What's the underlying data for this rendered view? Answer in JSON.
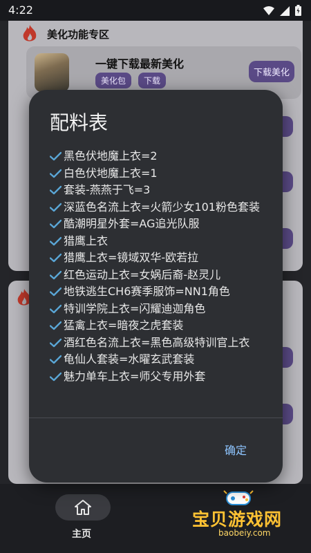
{
  "status_bar": {
    "time": "4:22",
    "icons": [
      "wifi-icon",
      "signal-icon",
      "battery-icon"
    ]
  },
  "background": {
    "section_title": "美化功能专区",
    "item": {
      "title": "一键下载最新美化",
      "tags": [
        "美化包",
        "下载"
      ],
      "download_label": "下载美化"
    }
  },
  "dialog": {
    "title": "配料表",
    "items": [
      "黑色伏地魔上衣=2",
      "白色伏地魔上衣=1",
      "套装-燕燕于飞=3",
      "深蓝色名流上衣=火箭少女101粉色套装",
      "酷潮明星外套=AG追光队服",
      "猎鹰上衣",
      "猎鹰上衣=镜域双华-欧若拉",
      "红色运动上衣=女娲后裔-赵灵儿",
      "地铁逃生CH6赛季服饰=NN1角色",
      "特训学院上衣=闪耀迪迦角色",
      "猛禽上衣=暗夜之虎套装",
      "酒红色名流上衣=黑色高级特训官上衣",
      "龟仙人套装=水曜玄武套装",
      "魅力单车上衣=师父专用外套"
    ],
    "confirm_label": "确定"
  },
  "bottom_nav": {
    "home_label": "主页"
  },
  "watermark": {
    "text": "宝贝游戏网",
    "url": "baobeiy.com"
  },
  "colors": {
    "accent_purple": "#5a4a86",
    "check_blue": "#5aa6d6",
    "confirm_blue": "#8ec5ff",
    "watermark_gold": "#ffc233"
  }
}
